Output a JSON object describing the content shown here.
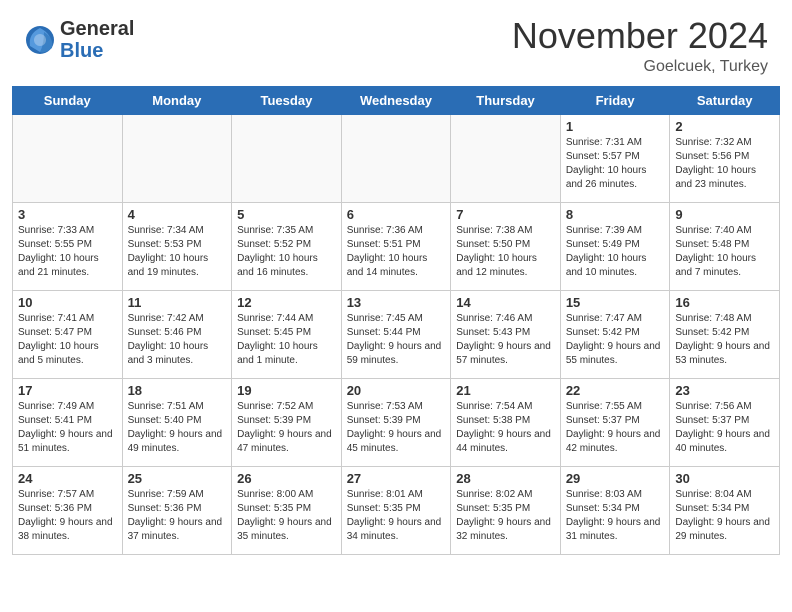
{
  "header": {
    "logo": {
      "general": "General",
      "blue": "Blue"
    },
    "title": "November 2024",
    "location": "Goelcuek, Turkey"
  },
  "weekdays": [
    "Sunday",
    "Monday",
    "Tuesday",
    "Wednesday",
    "Thursday",
    "Friday",
    "Saturday"
  ],
  "weeks": [
    [
      {
        "day": "",
        "info": ""
      },
      {
        "day": "",
        "info": ""
      },
      {
        "day": "",
        "info": ""
      },
      {
        "day": "",
        "info": ""
      },
      {
        "day": "",
        "info": ""
      },
      {
        "day": "1",
        "info": "Sunrise: 7:31 AM\nSunset: 5:57 PM\nDaylight: 10 hours and 26 minutes."
      },
      {
        "day": "2",
        "info": "Sunrise: 7:32 AM\nSunset: 5:56 PM\nDaylight: 10 hours and 23 minutes."
      }
    ],
    [
      {
        "day": "3",
        "info": "Sunrise: 7:33 AM\nSunset: 5:55 PM\nDaylight: 10 hours and 21 minutes."
      },
      {
        "day": "4",
        "info": "Sunrise: 7:34 AM\nSunset: 5:53 PM\nDaylight: 10 hours and 19 minutes."
      },
      {
        "day": "5",
        "info": "Sunrise: 7:35 AM\nSunset: 5:52 PM\nDaylight: 10 hours and 16 minutes."
      },
      {
        "day": "6",
        "info": "Sunrise: 7:36 AM\nSunset: 5:51 PM\nDaylight: 10 hours and 14 minutes."
      },
      {
        "day": "7",
        "info": "Sunrise: 7:38 AM\nSunset: 5:50 PM\nDaylight: 10 hours and 12 minutes."
      },
      {
        "day": "8",
        "info": "Sunrise: 7:39 AM\nSunset: 5:49 PM\nDaylight: 10 hours and 10 minutes."
      },
      {
        "day": "9",
        "info": "Sunrise: 7:40 AM\nSunset: 5:48 PM\nDaylight: 10 hours and 7 minutes."
      }
    ],
    [
      {
        "day": "10",
        "info": "Sunrise: 7:41 AM\nSunset: 5:47 PM\nDaylight: 10 hours and 5 minutes."
      },
      {
        "day": "11",
        "info": "Sunrise: 7:42 AM\nSunset: 5:46 PM\nDaylight: 10 hours and 3 minutes."
      },
      {
        "day": "12",
        "info": "Sunrise: 7:44 AM\nSunset: 5:45 PM\nDaylight: 10 hours and 1 minute."
      },
      {
        "day": "13",
        "info": "Sunrise: 7:45 AM\nSunset: 5:44 PM\nDaylight: 9 hours and 59 minutes."
      },
      {
        "day": "14",
        "info": "Sunrise: 7:46 AM\nSunset: 5:43 PM\nDaylight: 9 hours and 57 minutes."
      },
      {
        "day": "15",
        "info": "Sunrise: 7:47 AM\nSunset: 5:42 PM\nDaylight: 9 hours and 55 minutes."
      },
      {
        "day": "16",
        "info": "Sunrise: 7:48 AM\nSunset: 5:42 PM\nDaylight: 9 hours and 53 minutes."
      }
    ],
    [
      {
        "day": "17",
        "info": "Sunrise: 7:49 AM\nSunset: 5:41 PM\nDaylight: 9 hours and 51 minutes."
      },
      {
        "day": "18",
        "info": "Sunrise: 7:51 AM\nSunset: 5:40 PM\nDaylight: 9 hours and 49 minutes."
      },
      {
        "day": "19",
        "info": "Sunrise: 7:52 AM\nSunset: 5:39 PM\nDaylight: 9 hours and 47 minutes."
      },
      {
        "day": "20",
        "info": "Sunrise: 7:53 AM\nSunset: 5:39 PM\nDaylight: 9 hours and 45 minutes."
      },
      {
        "day": "21",
        "info": "Sunrise: 7:54 AM\nSunset: 5:38 PM\nDaylight: 9 hours and 44 minutes."
      },
      {
        "day": "22",
        "info": "Sunrise: 7:55 AM\nSunset: 5:37 PM\nDaylight: 9 hours and 42 minutes."
      },
      {
        "day": "23",
        "info": "Sunrise: 7:56 AM\nSunset: 5:37 PM\nDaylight: 9 hours and 40 minutes."
      }
    ],
    [
      {
        "day": "24",
        "info": "Sunrise: 7:57 AM\nSunset: 5:36 PM\nDaylight: 9 hours and 38 minutes."
      },
      {
        "day": "25",
        "info": "Sunrise: 7:59 AM\nSunset: 5:36 PM\nDaylight: 9 hours and 37 minutes."
      },
      {
        "day": "26",
        "info": "Sunrise: 8:00 AM\nSunset: 5:35 PM\nDaylight: 9 hours and 35 minutes."
      },
      {
        "day": "27",
        "info": "Sunrise: 8:01 AM\nSunset: 5:35 PM\nDaylight: 9 hours and 34 minutes."
      },
      {
        "day": "28",
        "info": "Sunrise: 8:02 AM\nSunset: 5:35 PM\nDaylight: 9 hours and 32 minutes."
      },
      {
        "day": "29",
        "info": "Sunrise: 8:03 AM\nSunset: 5:34 PM\nDaylight: 9 hours and 31 minutes."
      },
      {
        "day": "30",
        "info": "Sunrise: 8:04 AM\nSunset: 5:34 PM\nDaylight: 9 hours and 29 minutes."
      }
    ]
  ]
}
